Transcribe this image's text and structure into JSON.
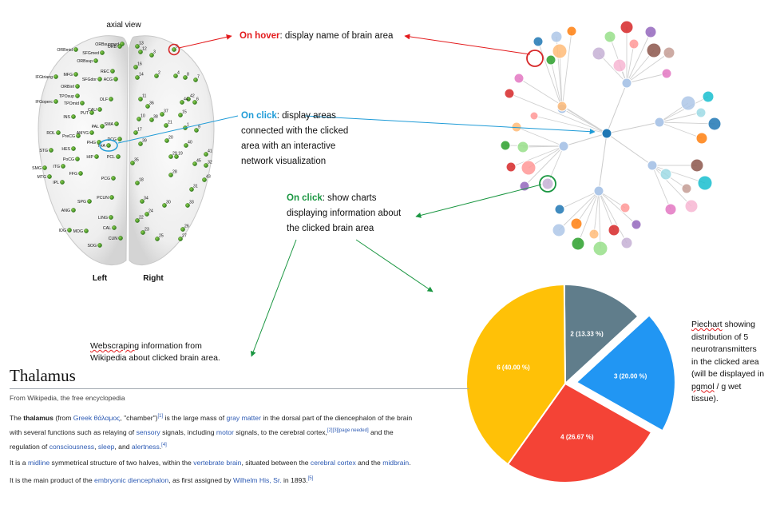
{
  "brain": {
    "title": "axial view",
    "left_label": "Left",
    "right_label": "Right",
    "area_labels": [
      "ORB",
      "ORBsupmed",
      "ORBmid",
      "SFGmed",
      "ORBsup",
      "IFGtriang",
      "MFG",
      "SFGdor",
      "REC",
      "ACG",
      "ORBinf",
      "IFGoperc",
      "TPOsup",
      "TPOmid",
      "INS",
      "PUT",
      "OLF",
      "CAU",
      "PAL",
      "SMA",
      "AMYG",
      "ROL",
      "PreCG",
      "THA",
      "PHG",
      "DCG",
      "PCL",
      "STG",
      "HES",
      "PoCG",
      "HIP",
      "MTG",
      "ITG",
      "SMG",
      "FFG",
      "IPL",
      "PCG",
      "SPG",
      "PCUN",
      "ANG",
      "LING",
      "IOG",
      "MOG",
      "CAL",
      "SOG",
      "CUN"
    ],
    "right_numbers": [
      "13",
      "12",
      "3",
      "5",
      "16",
      "14",
      "2",
      "4",
      "8",
      "7",
      "11",
      "36",
      "42",
      "44",
      "6",
      "37",
      "10",
      "38",
      "15",
      "21",
      "17",
      "1",
      "20",
      "39",
      "19",
      "40",
      "41",
      "29",
      "9",
      "35",
      "45",
      "32",
      "28",
      "43",
      "18",
      "31",
      "34",
      "30",
      "33",
      "22",
      "24",
      "26",
      "23",
      "25",
      "27"
    ],
    "highlight_label": "THA"
  },
  "callouts": {
    "hover": {
      "lead": "On hover",
      "rest": ": display name of brain area"
    },
    "click_network": {
      "lead": "On click",
      "rest": ": display areas",
      "lines": [
        "connected with the clicked",
        "area with an interactive",
        "network visualization"
      ]
    },
    "click_charts": {
      "lead": "On click",
      "rest": ": show charts",
      "lines": [
        "displaying information about",
        "the clicked brain area"
      ]
    }
  },
  "network": {
    "colors": [
      "#1f77b4",
      "#aec7e8",
      "#ff7f0e",
      "#ffbb78",
      "#2ca02c",
      "#98df8a",
      "#d62728",
      "#ff9896",
      "#9467bd",
      "#c5b0d5",
      "#8c564b",
      "#c49c94",
      "#e377c2",
      "#f7b6d2",
      "#17becf",
      "#9edae5"
    ]
  },
  "scraping_note": {
    "word": "Webscraping",
    "rest": " information from",
    "line2": "Wikipedia about clicked brain area."
  },
  "wiki": {
    "title": "Thalamus",
    "subtitle": "From Wikipedia, the free encyclopedia",
    "p1_a": "The ",
    "p1_bold": "thalamus",
    "p1_b": " (from ",
    "p1_link_greek": "Greek",
    "p1_greek": " θάλαμος",
    "p1_c": ", \"chamber\")",
    "p1_sup1": "[1]",
    "p1_d": " is the large mass of ",
    "p1_link_gray": "gray matter",
    "p1_e": " in the dorsal part of the diencephalon of the brain",
    "p1_f": "with several functions such as relaying of ",
    "p1_link_sensory": "sensory",
    "p1_g": " signals, including ",
    "p1_link_motor": "motor",
    "p1_h": " signals, to the cerebral cortex,",
    "p1_sup2": "[2][3][page needed]",
    "p1_i": " and the",
    "p1_j": "regulation of ",
    "p1_link_consc": "consciousness",
    "p1_k": ", ",
    "p1_link_sleep": "sleep",
    "p1_l": ", and ",
    "p1_link_alert": "alertness",
    "p1_m": ".",
    "p1_sup3": "[4]",
    "p2_a": "It is a ",
    "p2_link_midline": "midline",
    "p2_b": " symmetrical structure of two halves, within the ",
    "p2_link_vert": "vertebrate brain",
    "p2_c": ", situated between the ",
    "p2_link_cortex": "cerebral cortex",
    "p2_d": " and the ",
    "p2_link_mid": "midbrain",
    "p2_e": ".",
    "p3_a": "It is the main product of the ",
    "p3_link_emb": "embryonic diencephalon",
    "p3_b": ", as first assigned by ",
    "p3_link_his": "Wilhelm His, Sr.",
    "p3_c": " in 1893.",
    "p3_sup": "[5]"
  },
  "pie_note": {
    "word": "Piechart",
    "rest": " showing",
    "lines": [
      "distribution of 5",
      "neurotransmitters",
      "in the clicked area",
      "(will be displayed in"
    ],
    "unit_word": "pgmol",
    "unit_rest": " / g wet",
    "last": "tissue)."
  },
  "chart_data": {
    "type": "pie",
    "slices": [
      {
        "label": "2 (13.33 %)",
        "value": 13.33,
        "color": "#607d8b",
        "exploded": false
      },
      {
        "label": "3 (20.00 %)",
        "value": 20.0,
        "color": "#2196f3",
        "exploded": true
      },
      {
        "label": "4 (26.67 %)",
        "value": 26.67,
        "color": "#f44336",
        "exploded": false
      },
      {
        "label": "6 (40.00 %)",
        "value": 40.0,
        "color": "#ffc107",
        "exploded": false
      }
    ]
  }
}
